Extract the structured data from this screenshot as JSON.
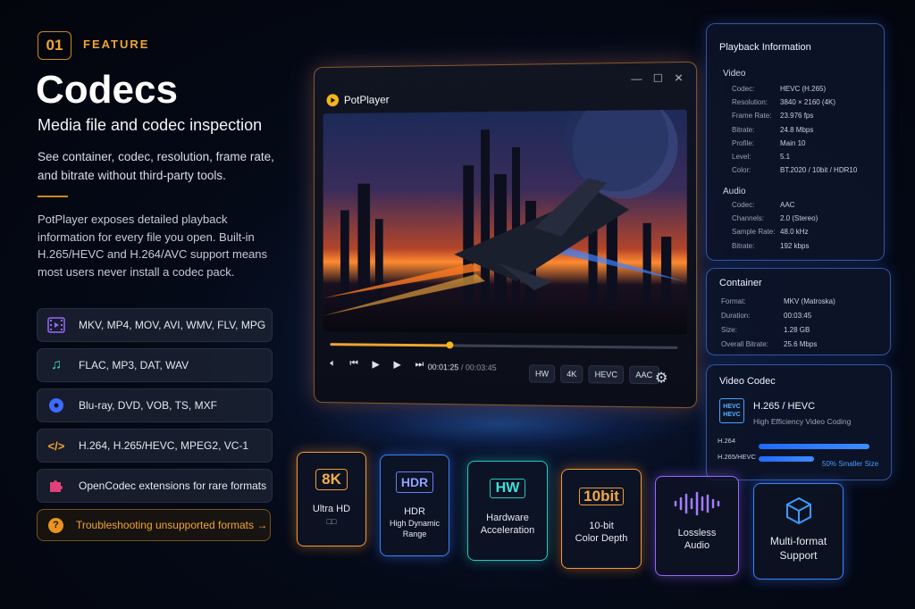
{
  "feature": {
    "number": "01",
    "label": "FEATURE"
  },
  "title": "Codecs",
  "subtitle": "Media file and codec inspection",
  "description": "See container, codec, resolution, frame rate, and bitrate without third-party tools.",
  "paragraph": "PotPlayer exposes detailed playback information for every file you open. Built-in H.265/HEVC and H.264/AVC support means most users never install a codec pack.",
  "formats": [
    {
      "icon": "film-icon",
      "text": "MKV, MP4, MOV, AVI, WMV, FLV, MPG"
    },
    {
      "icon": "music-note-icon",
      "text": "FLAC, MP3, DAT, WAV"
    },
    {
      "icon": "disc-icon",
      "text": "Blu-ray, DVD, VOB, TS, MXF"
    },
    {
      "icon": "code-icon",
      "text": "H.264, H.265/HEVC, MPEG2, VC-1"
    },
    {
      "icon": "puzzle-icon",
      "text": "OpenCodec extensions for rare formats"
    }
  ],
  "troubleshoot": {
    "icon": "question-icon",
    "label": "Troubleshooting unsupported formats →"
  },
  "player": {
    "app_name": "PotPlayer",
    "time_current": "00:01:25",
    "time_total": "/ 00:03:45",
    "progress": 0.35,
    "tags": [
      "HW",
      "4K",
      "HEVC",
      "AAC"
    ]
  },
  "playback_info": {
    "title": "Playback Information",
    "video_label": "Video",
    "video": [
      {
        "k": "Codec:",
        "v": "HEVC (H.265)"
      },
      {
        "k": "Resolution:",
        "v": "3840 × 2160 (4K)"
      },
      {
        "k": "Frame Rate:",
        "v": "23.976 fps"
      },
      {
        "k": "Bitrate:",
        "v": "24.8 Mbps"
      },
      {
        "k": "Profile:",
        "v": "Main 10"
      },
      {
        "k": "Level:",
        "v": "5.1"
      },
      {
        "k": "Color:",
        "v": "BT.2020 / 10bit / HDR10"
      }
    ],
    "audio_label": "Audio",
    "audio": [
      {
        "k": "Codec:",
        "v": "AAC"
      },
      {
        "k": "Channels:",
        "v": "2.0 (Stereo)"
      },
      {
        "k": "Sample Rate:",
        "v": "48.0 kHz"
      },
      {
        "k": "Bitrate:",
        "v": "192 kbps"
      }
    ]
  },
  "container": {
    "title": "Container",
    "rows": [
      {
        "k": "Format:",
        "v": "MKV (Matroska)"
      },
      {
        "k": "Duration:",
        "v": "00:03:45"
      },
      {
        "k": "Size:",
        "v": "1.28 GB"
      },
      {
        "k": "Overall Bitrate:",
        "v": "25.6 Mbps"
      }
    ]
  },
  "video_codec": {
    "title": "Video Codec",
    "icon_text_1": "HEVC",
    "icon_text_2": "HEVC",
    "name": "H.265 / HEVC",
    "subtitle": "High Efficiency Video Coding",
    "bar1_label": "H.264",
    "bar2_label": "H.265/HEVC",
    "bar1_value": 1.0,
    "bar2_value": 0.5,
    "saving": "50% Smaller Size"
  },
  "cards": [
    {
      "badge": "8K",
      "line1": "Ultra HD",
      "line2": "□□"
    },
    {
      "badge": "HDR",
      "line1": "HDR",
      "line2": "High Dynamic Range"
    },
    {
      "badge": "HW",
      "line1": "Hardware",
      "line2": "Acceleration"
    },
    {
      "badge": "10bit",
      "line1": "10-bit",
      "line2": "Color Depth"
    },
    {
      "badge": "",
      "line1": "Lossless",
      "line2": "Audio"
    },
    {
      "badge": "",
      "line1": "Multi-format",
      "line2": "Support"
    }
  ],
  "colors": {
    "accent": "#f0a530",
    "blue": "#3d82ff",
    "teal": "#23c8c0",
    "purple": "#9a66ff"
  }
}
